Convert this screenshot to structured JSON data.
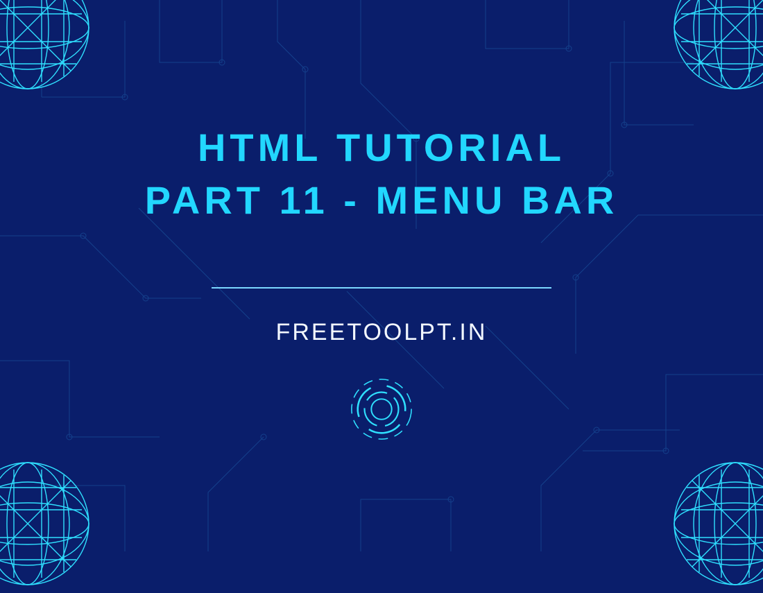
{
  "heading": "HTML TUTORIAL\nPART 11 - MENU BAR",
  "subtitle": "FREETOOLPT.IN",
  "colors": {
    "bg": "#0a1e6b",
    "accent": "#22d7ff",
    "text": "#f2f7ff"
  }
}
